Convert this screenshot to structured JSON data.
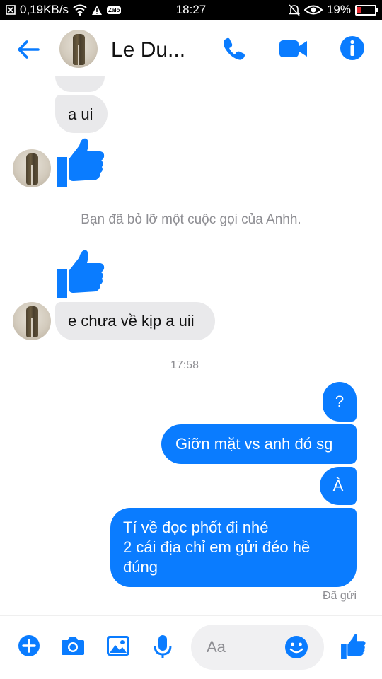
{
  "status_bar": {
    "speed": "0,19KB/s",
    "zalo_label": "Zalo",
    "time": "18:27",
    "battery": "19%",
    "battery_level": 0.19
  },
  "header": {
    "contact_name": "Le Du..."
  },
  "messages": {
    "incoming_1": "a ui",
    "missed_call": "Bạn đã bỏ lỡ một cuộc gọi của Anhh.",
    "incoming_2": "e chưa về kịp a uii",
    "timestamp": "17:58",
    "outgoing_1": "?",
    "outgoing_2": "Giỡn mặt vs anh đó sg",
    "outgoing_3": "À",
    "outgoing_4_line1": "Tí về đọc phốt đi nhé",
    "outgoing_4_line2": "2 cái địa chỉ em gửi đéo hề",
    "outgoing_4_line3": "đúng",
    "sent_status": "Đã gửi"
  },
  "composer": {
    "placeholder": "Aa"
  },
  "colors": {
    "accent": "#0a7cff",
    "incoming_bubble": "#e9e9eb",
    "meta_text": "#8e8e93"
  }
}
